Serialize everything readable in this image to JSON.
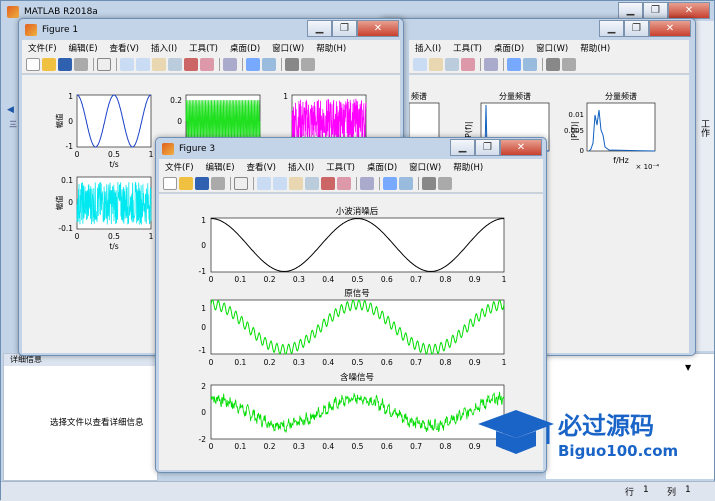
{
  "main_window": {
    "title": "MATLAB R2018a",
    "right_tab": "工作",
    "details_label": "详细信息",
    "details_hint": "选择文件以查看详细信息",
    "status_row_label": "行",
    "status_row_value": "1",
    "status_col_label": "列",
    "status_col_value": "1"
  },
  "figure1": {
    "title": "Figure 1",
    "menus": [
      "文件(F)",
      "编辑(E)",
      "查看(V)",
      "插入(I)",
      "工具(T)",
      "桌面(D)",
      "窗口(W)",
      "帮助(H)"
    ],
    "y_label": "幅值",
    "x_label": "t/s"
  },
  "figure2": {
    "menus": [
      "插入(I)",
      "工具(T)",
      "桌面(D)",
      "窗口(W)",
      "帮助(H)"
    ],
    "plot_titles": [
      "频谱",
      "分量频谱",
      "分量频谱"
    ],
    "y_label": "|P(f)|",
    "x_label": "f/Hz",
    "exp_label": "× 10⁻⁴"
  },
  "figure3": {
    "title": "Figure 3",
    "menus": [
      "文件(F)",
      "编辑(E)",
      "查看(V)",
      "插入(I)",
      "工具(T)",
      "桌面(D)",
      "窗口(W)",
      "帮助(H)"
    ],
    "plots": [
      {
        "title": "小波消噪后",
        "yticks": [
          "1",
          "0",
          "-1"
        ],
        "color": "#000000"
      },
      {
        "title": "原信号",
        "yticks": [
          "1",
          "0",
          "-1"
        ],
        "color": "#00dd00"
      },
      {
        "title": "含噪信号",
        "yticks": [
          "2",
          "0",
          "-2"
        ],
        "color": "#00dd00"
      }
    ],
    "xticks": [
      "0",
      "0.1",
      "0.2",
      "0.3",
      "0.4",
      "0.5",
      "0.6",
      "0.7",
      "0.8",
      "0.9",
      "1"
    ]
  },
  "watermark": {
    "brand": "必过源码",
    "url": "Biguo100.com"
  },
  "chart_data": [
    {
      "type": "line",
      "title": "小波消噪后",
      "x_range": [
        0,
        1
      ],
      "ylim": [
        -1,
        1
      ],
      "series": [
        {
          "color": "#000000",
          "description": "y = cos(4πt), denoised"
        }
      ]
    },
    {
      "type": "line",
      "title": "原信号",
      "x_range": [
        0,
        1
      ],
      "ylim": [
        -1.2,
        1.2
      ],
      "series": [
        {
          "color": "#00dd00",
          "description": "cos(4πt) + 0.2·sin(100πt)"
        }
      ]
    },
    {
      "type": "line",
      "title": "含噪信号",
      "x_range": [
        0,
        1
      ],
      "ylim": [
        -2,
        2
      ],
      "series": [
        {
          "color": "#00dd00",
          "description": "original + random noise"
        }
      ]
    }
  ]
}
